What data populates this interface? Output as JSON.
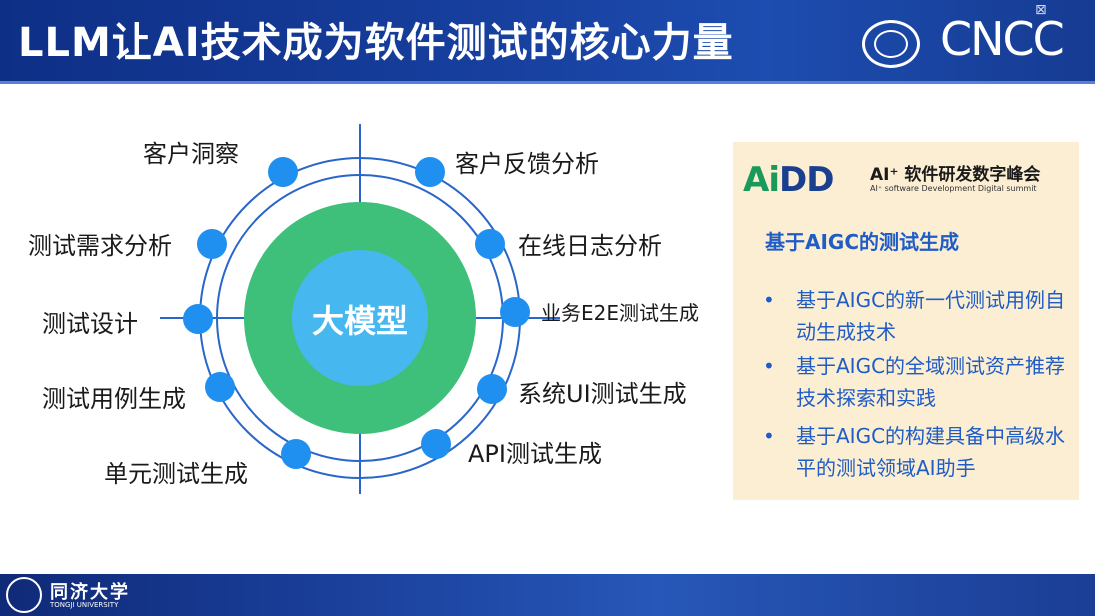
{
  "header": {
    "title": "LLM让AI技术成为软件测试的核心力量",
    "conference_logo": "CNCC",
    "seal_icon": "ccf-seal-icon",
    "window_icon": "⊠"
  },
  "diagram": {
    "center": "大模型",
    "nodes_left": [
      "客户洞察",
      "测试需求分析",
      "测试设计",
      "测试用例生成",
      "单元测试生成"
    ],
    "nodes_right": [
      "客户反馈分析",
      "在线日志分析",
      "业务E2E测试生成",
      "系统UI测试生成",
      "API测试生成"
    ],
    "colors": {
      "outer_ring": "#3ec07a",
      "inner_circle": "#46b8ef",
      "node": "#1f8ff0",
      "orbit": "#2a66c9"
    }
  },
  "panel": {
    "logo_text_a": "Ai",
    "logo_text_b": "DD",
    "name": "AI⁺ 软件研发数字峰会",
    "subtitle": "AI⁺ software Development Digital summit",
    "heading": "基于AIGC的测试生成",
    "bullet_char": "•",
    "bullets": [
      "基于AIGC的新一代测试用例自动生成技术",
      "基于AIGC的全域测试资产推荐技术探索和实践",
      "基于AIGC的构建具备中高级水平的测试领域AI助手"
    ],
    "colors": {
      "background": "#fbeed3",
      "heading": "#1f5cc6"
    }
  },
  "footer": {
    "university": "同济大学",
    "university_en": "TONGJI UNIVERSITY"
  }
}
